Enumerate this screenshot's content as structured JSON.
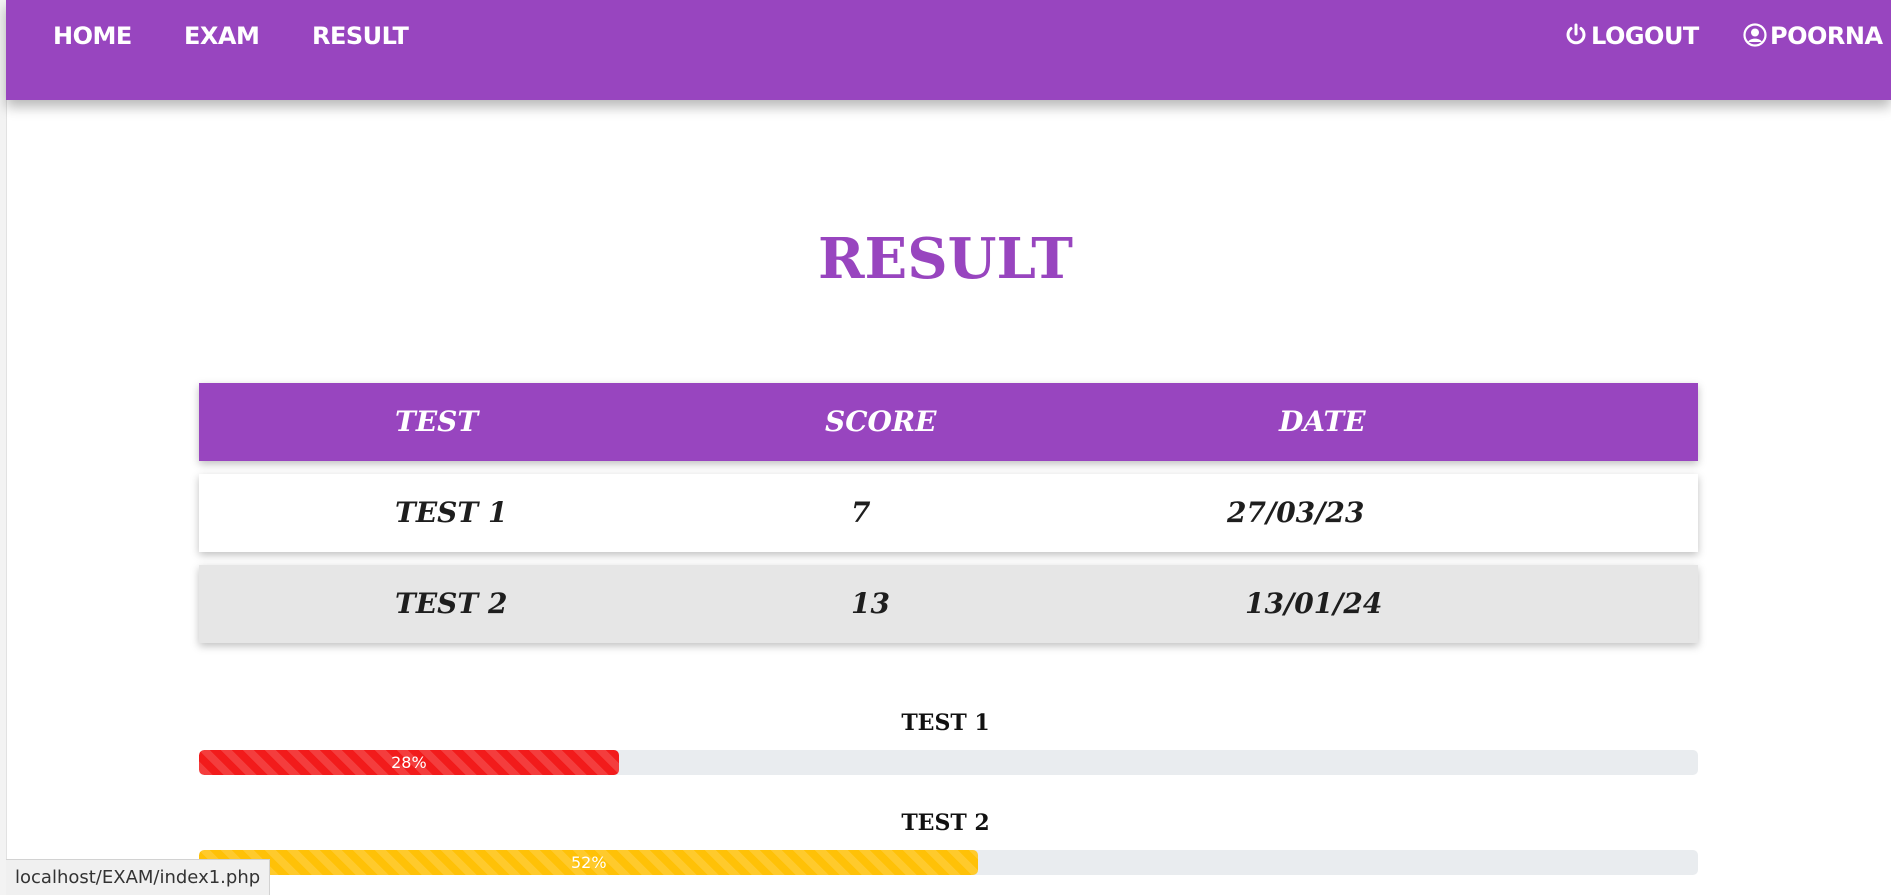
{
  "navbar": {
    "color": "#9845bf",
    "home_label": "HOME",
    "exam_label": "EXAM",
    "result_label": "RESULT",
    "logout_label": "LOGOUT",
    "user_label": "POORNA",
    "logout_icon": "power-icon",
    "user_icon": "user-circle-icon"
  },
  "page": {
    "title": "RESULT"
  },
  "table": {
    "headers": [
      "TEST",
      "SCORE",
      "DATE"
    ],
    "rows": [
      {
        "test": "TEST 1",
        "score": "7",
        "date": "27/03/23"
      },
      {
        "test": "TEST 2",
        "score": "13",
        "date": "13/01/24"
      }
    ]
  },
  "progress": [
    {
      "title": "TEST 1",
      "percent": 28,
      "label": "28%",
      "color": "#f21b1b"
    },
    {
      "title": "TEST 2",
      "percent": 52,
      "label": "52%",
      "color": "#ffc107"
    }
  ],
  "status_bar": {
    "url": "localhost/EXAM/index1.php"
  }
}
